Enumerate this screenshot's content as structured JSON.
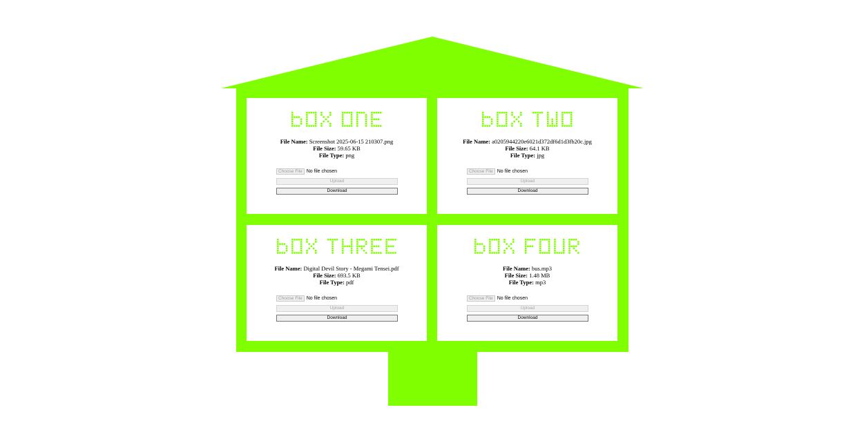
{
  "theme": {
    "house_color": "#80ff00"
  },
  "boxes": [
    {
      "title": "BOX ONE",
      "file_name_label": "File Name:",
      "file_name": "Screenshot 2025-06-15 210307.png",
      "file_size_label": "File Size:",
      "file_size": "59.65 KB",
      "file_type_label": "File Type:",
      "file_type": "png",
      "choose_label": "Choose File",
      "no_file_text": "No file chosen",
      "upload_label": "Upload",
      "download_label": "Download"
    },
    {
      "title": "BOX TWO",
      "file_name_label": "File Name:",
      "file_name": "a0205944220e6021d372df6d1d3fb20c.jpg",
      "file_size_label": "File Size:",
      "file_size": "64.1 KB",
      "file_type_label": "File Type:",
      "file_type": "jpg",
      "choose_label": "Choose File",
      "no_file_text": "No file chosen",
      "upload_label": "Upload",
      "download_label": "Download"
    },
    {
      "title": "BOX THREE",
      "file_name_label": "File Name:",
      "file_name": "Digital Devil Story - Megami Tensei.pdf",
      "file_size_label": "File Size:",
      "file_size": "693.5 KB",
      "file_type_label": "File Type:",
      "file_type": "pdf",
      "choose_label": "Choose File",
      "no_file_text": "No file chosen",
      "upload_label": "Upload",
      "download_label": "Download"
    },
    {
      "title": "BOX FOUR",
      "file_name_label": "File Name:",
      "file_name": "bus.mp3",
      "file_size_label": "File Size:",
      "file_size": "1.48 MB",
      "file_type_label": "File Type:",
      "file_type": "mp3",
      "choose_label": "Choose File",
      "no_file_text": "No file chosen",
      "upload_label": "Upload",
      "download_label": "Download"
    }
  ]
}
